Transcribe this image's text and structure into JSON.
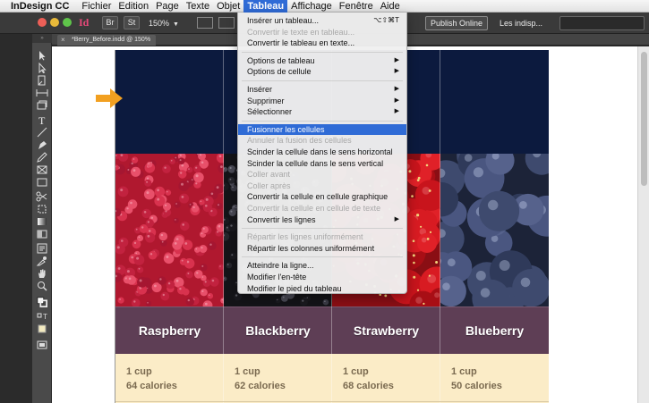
{
  "menubar": {
    "app_name": "InDesign CC",
    "items": [
      "Fichier",
      "Edition",
      "Page",
      "Texte",
      "Objet",
      "Tableau",
      "Affichage",
      "Fenêtre",
      "Aide"
    ],
    "active_index": 5
  },
  "control_bar": {
    "logo": "Id",
    "btn_br": "Br",
    "btn_st": "St",
    "zoom": "150%",
    "publish": "Publish Online",
    "workspace": "Les indisp..."
  },
  "document_tab": {
    "title": "*Berry_Before.indd @ 150%"
  },
  "tableau_menu": {
    "items": [
      {
        "label": "Insérer un tableau...",
        "shortcut": "⌥⇧⌘T",
        "state": "enabled"
      },
      {
        "label": "Convertir le texte en tableau...",
        "state": "disabled"
      },
      {
        "label": "Convertir le tableau en texte...",
        "state": "enabled"
      },
      {
        "sep": true
      },
      {
        "label": "Options de tableau",
        "submenu": true,
        "state": "enabled"
      },
      {
        "label": "Options de cellule",
        "submenu": true,
        "state": "enabled"
      },
      {
        "sep": true
      },
      {
        "label": "Insérer",
        "submenu": true,
        "state": "enabled"
      },
      {
        "label": "Supprimer",
        "submenu": true,
        "state": "enabled"
      },
      {
        "label": "Sélectionner",
        "submenu": true,
        "state": "enabled"
      },
      {
        "sep": true
      },
      {
        "label": "Fusionner les cellules",
        "state": "highlighted"
      },
      {
        "label": "Annuler la fusion des cellules",
        "state": "disabled"
      },
      {
        "label": "Scinder la cellule dans le sens horizontal",
        "state": "enabled"
      },
      {
        "label": "Scinder la cellule dans le sens vertical",
        "state": "enabled"
      },
      {
        "label": "Coller avant",
        "state": "disabled"
      },
      {
        "label": "Coller après",
        "state": "disabled"
      },
      {
        "label": "Convertir la cellule en cellule graphique",
        "state": "enabled"
      },
      {
        "label": "Convertir la cellule en cellule de texte",
        "state": "disabled"
      },
      {
        "label": "Convertir les lignes",
        "submenu": true,
        "state": "enabled"
      },
      {
        "sep": true
      },
      {
        "label": "Répartir les lignes uniformément",
        "state": "disabled"
      },
      {
        "label": "Répartir les colonnes uniformément",
        "state": "enabled"
      },
      {
        "sep": true
      },
      {
        "label": "Atteindre la ligne...",
        "state": "enabled"
      },
      {
        "label": "Modifier l'en-tête",
        "state": "enabled"
      },
      {
        "label": "Modifier le pied du tableau",
        "state": "enabled"
      }
    ]
  },
  "table": {
    "columns": [
      {
        "name": "Raspberry",
        "qty": "1 cup",
        "calories": "64 calories",
        "photo": "raspberry"
      },
      {
        "name": "Blackberry",
        "qty": "1 cup",
        "calories": "62 calories",
        "photo": "blackberry"
      },
      {
        "name": "Strawberry",
        "qty": "1 cup",
        "calories": "68 calories",
        "photo": "strawberry"
      },
      {
        "name": "Blueberry",
        "qty": "1 cup",
        "calories": "50 calories",
        "photo": "blueberry"
      }
    ]
  },
  "colors": {
    "header_navy": "#0c1a3e",
    "name_row": "#5e3e55",
    "info_row": "#fbecc7",
    "menu_highlight": "#2f6bd6",
    "arrow": "#f2a020"
  }
}
